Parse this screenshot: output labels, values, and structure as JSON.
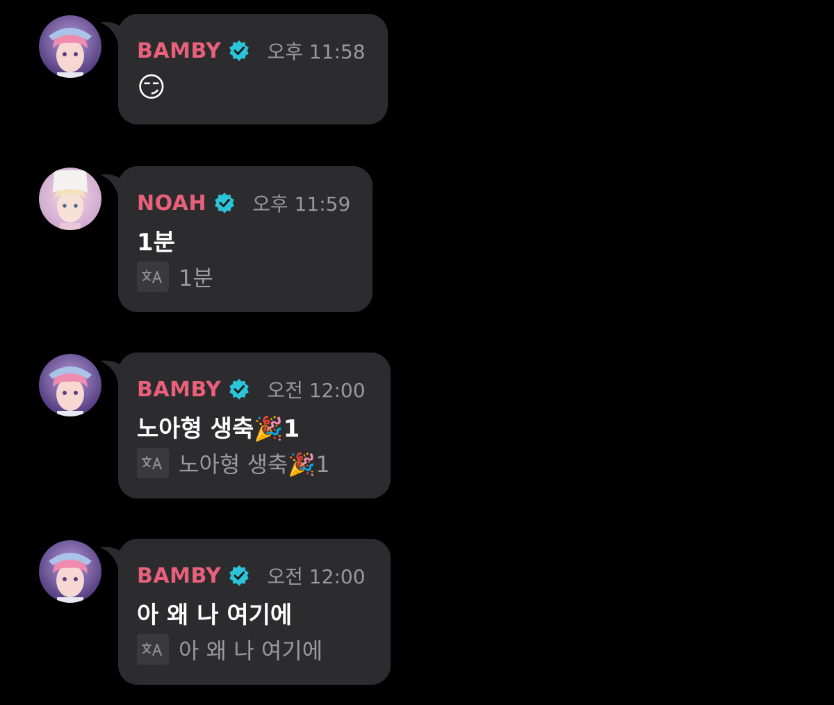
{
  "colors": {
    "background": "#000000",
    "bubble": "#2c2c2e",
    "name": "#e8607a",
    "verified": "#2bc4d8",
    "timestamp": "#9a9a9e"
  },
  "messages": [
    {
      "avatar": "bamby-avatar",
      "sender": "BAMBY",
      "verified_icon": "verified-badge-icon",
      "time": "오후 11:58",
      "text": "😏",
      "translation_icon": "translate-icon",
      "translation": ""
    },
    {
      "avatar": "noah-avatar",
      "sender": "NOAH",
      "verified_icon": "verified-badge-icon",
      "time": "오후 11:59",
      "text": "1분",
      "translation_icon": "translate-icon",
      "translation": "1분"
    },
    {
      "avatar": "bamby-avatar",
      "sender": "BAMBY",
      "verified_icon": "verified-badge-icon",
      "time": "오전 12:00",
      "text": "노아형 생축🎉1",
      "translation_icon": "translate-icon",
      "translation": "노아형 생축🎉1"
    },
    {
      "avatar": "bamby-avatar",
      "sender": "BAMBY",
      "verified_icon": "verified-badge-icon",
      "time": "오전 12:00",
      "text": "아 왜 나 여기에",
      "translation_icon": "translate-icon",
      "translation": "아 왜 나 여기에"
    }
  ]
}
